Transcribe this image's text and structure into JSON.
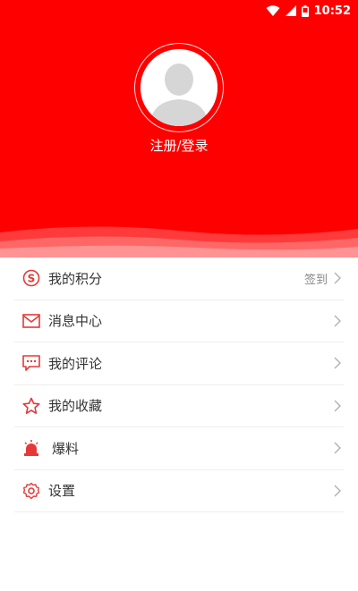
{
  "status_bar": {
    "time": "10:52",
    "wifi_icon": "wifi-icon",
    "signal_icon": "signal-icon",
    "battery_icon": "battery-icon"
  },
  "header": {
    "login_label": "注册/登录",
    "avatar_icon": "default-avatar-icon"
  },
  "colors": {
    "brand": "#ff0000",
    "divider": "#eeeeee",
    "text": "#333333",
    "subtle": "#888888"
  },
  "menu": {
    "items": [
      {
        "label": "我的积分",
        "icon": "points-icon",
        "extra": "签到"
      },
      {
        "label": "消息中心",
        "icon": "mail-icon",
        "extra": ""
      },
      {
        "label": "我的评论",
        "icon": "comment-icon",
        "extra": ""
      },
      {
        "label": "我的收藏",
        "icon": "star-icon",
        "extra": ""
      },
      {
        "label": "爆料",
        "icon": "alarm-light-icon",
        "extra": ""
      },
      {
        "label": "设置",
        "icon": "gear-icon",
        "extra": ""
      }
    ]
  }
}
